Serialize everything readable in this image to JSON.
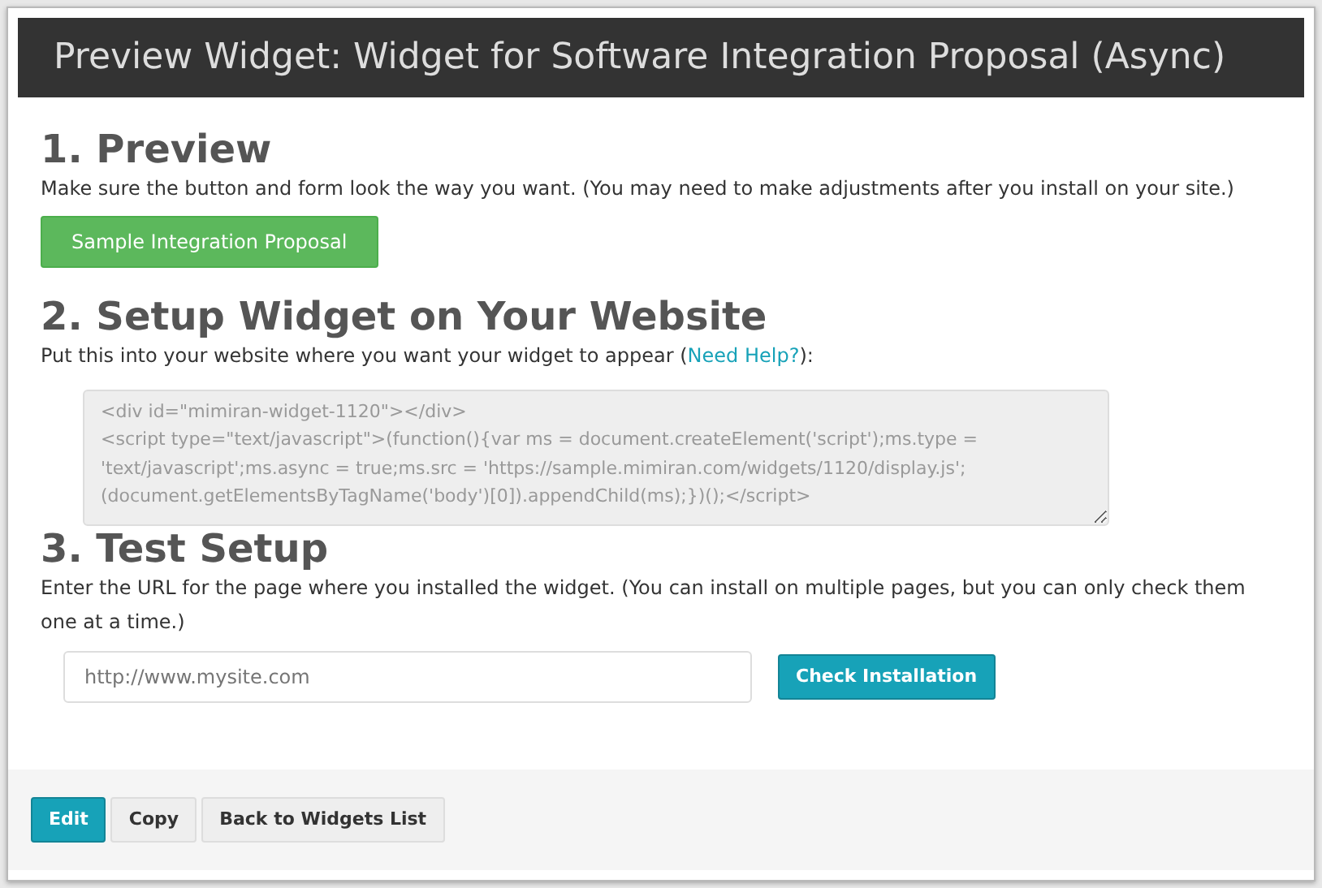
{
  "window": {
    "title": "Preview Widget: Widget for Software Integration Proposal (Async)"
  },
  "preview": {
    "heading": "1. Preview",
    "description": "Make sure the button and form look the way you want. (You may need to make adjustments after you install on your site.)",
    "sample_button": "Sample Integration Proposal"
  },
  "setup": {
    "heading": "2. Setup Widget on Your Website",
    "description_before": "Put this into your website where you want your widget to appear (",
    "help_link": "Need Help?",
    "description_after": "):",
    "code_lines": [
      "<div id=\"mimiran-widget-1120\"></div>",
      "<script type=\"text/javascript\">(function(){var ms = document.createElement('script');ms.type =",
      "'text/javascript';ms.async = true;ms.src = 'https://sample.mimiran.com/widgets/1120/display.js';",
      "(document.getElementsByTagName('body')[0]).appendChild(ms);})();</script>"
    ]
  },
  "test": {
    "heading": "3. Test Setup",
    "description": "Enter the URL for the page where you installed the widget. (You can install on multiple pages, but you can only check them one at a time.)",
    "url_field": {
      "placeholder": "http://www.mysite.com"
    },
    "check_button": "Check Installation"
  },
  "footer_buttons": [
    {
      "label": "Edit",
      "kind": "primary"
    },
    {
      "label": "Copy",
      "kind": "secondary"
    },
    {
      "label": "Back to Widgets List",
      "kind": "secondary"
    }
  ]
}
